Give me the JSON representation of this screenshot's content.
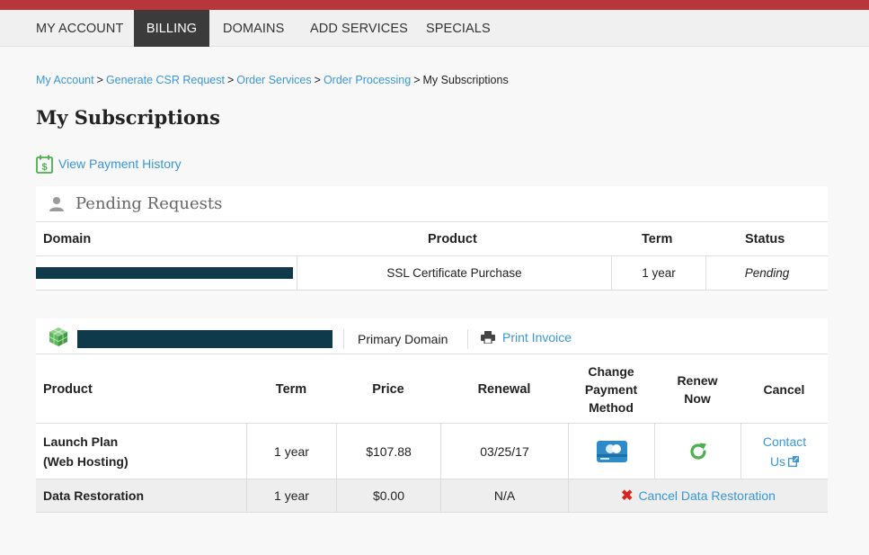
{
  "nav": {
    "items": [
      "MY ACCOUNT",
      "BILLING",
      "DOMAINS",
      "ADD SERVICES",
      "SPECIALS"
    ],
    "active": "BILLING"
  },
  "breadcrumb": {
    "links": [
      "My Account",
      "Generate CSR Request",
      "Order Services",
      "Order Processing"
    ],
    "current": "My Subscriptions",
    "separator": ">"
  },
  "page_title": "My Subscriptions",
  "payment_history_link": "View Payment History",
  "pending": {
    "title": "Pending Requests",
    "columns": [
      "Domain",
      "Product",
      "Term",
      "Status"
    ],
    "row": {
      "domain_redacted": true,
      "product": "SSL Certificate Purchase",
      "term": "1 year",
      "status": "Pending"
    }
  },
  "subscription": {
    "domain_redacted": true,
    "primary_domain_label": "Primary Domain",
    "print_invoice": "Print Invoice",
    "columns": {
      "product": "Product",
      "term": "Term",
      "price": "Price",
      "renewal": "Renewal",
      "change_payment_1": "Change",
      "change_payment_2": "Payment",
      "change_payment_3": "Method",
      "renew_1": "Renew",
      "renew_2": "Now",
      "cancel": "Cancel"
    },
    "rows": [
      {
        "product_line1": "Launch Plan",
        "product_line2": "(Web Hosting)",
        "term": "1 year",
        "price": "$107.88",
        "renewal": "03/25/17",
        "cancel_line1": "Contact",
        "cancel_line2": "Us"
      },
      {
        "product": "Data Restoration",
        "term": "1 year",
        "price": "$0.00",
        "renewal": "N/A",
        "cancel_action": "Cancel Data Restoration"
      }
    ]
  },
  "colors": {
    "top_stripe": "#b8353a",
    "active_nav": "#3b3b3b",
    "link": "#3a97d6",
    "redaction": "#0e3a4b",
    "renew_green": "#4caf50",
    "cancel_red": "#d9261c"
  }
}
